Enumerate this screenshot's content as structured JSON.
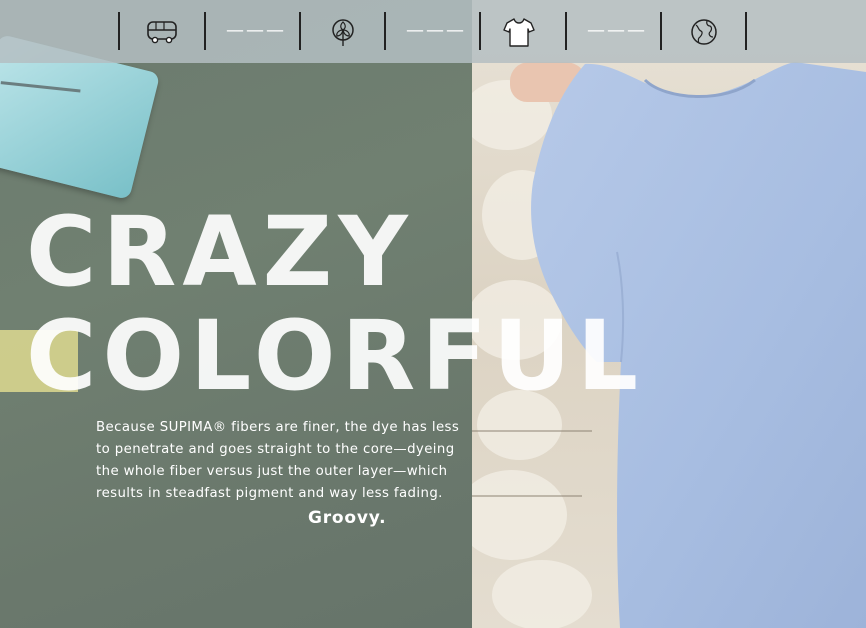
{
  "topbar": {
    "items": [
      {
        "type": "icon",
        "icon": "bus-icon"
      },
      {
        "type": "dash",
        "text": "———"
      },
      {
        "type": "icon",
        "icon": "cotton-plant-icon"
      },
      {
        "type": "dash",
        "text": "———"
      },
      {
        "type": "icon",
        "icon": "tshirt-icon"
      },
      {
        "type": "dash",
        "text": "———"
      },
      {
        "type": "icon",
        "icon": "globe-icon"
      }
    ]
  },
  "headline": {
    "line1": "CRAZY",
    "line2": "COLORFUL"
  },
  "body": {
    "paragraph": "Because SUPIMA® fibers are finer, the dye has less to penetrate and goes straight to the core—dyeing the whole fiber versus just the outer layer—which results in steadfast pigment and way less fading.",
    "tagline": "Groovy."
  },
  "colors": {
    "left_panel": "#6f7d72",
    "shirt": "#a9c0e3",
    "accent_yellow": "#e8e294",
    "topbar": "#b4bec2"
  }
}
